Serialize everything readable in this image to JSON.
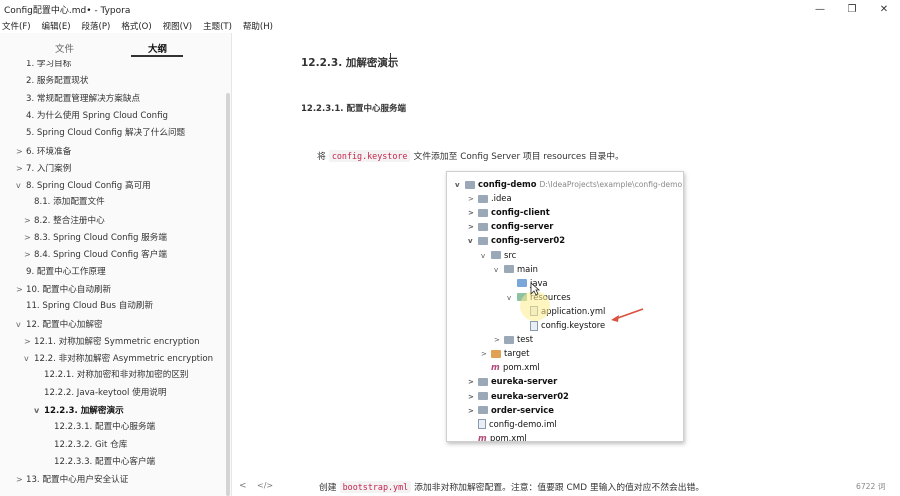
{
  "window": {
    "title": "Config配置中心.md• - Typora",
    "controls": {
      "minimize": "—",
      "maximize": "❐",
      "close": "✕"
    }
  },
  "menu": [
    "文件(F)",
    "编辑(E)",
    "段落(P)",
    "格式(O)",
    "视图(V)",
    "主题(T)",
    "帮助(H)"
  ],
  "sidebar": {
    "tabs": [
      "文件",
      "大纲"
    ],
    "active_tab": "大纲",
    "outline": [
      {
        "label": "1. 学习目标",
        "twisty": ""
      },
      {
        "label": "2. 服务配置现状",
        "twisty": ""
      },
      {
        "label": "3. 常规配置管理解决方案缺点",
        "twisty": ""
      },
      {
        "label": "4. 为什么使用 Spring Cloud Config",
        "twisty": ""
      },
      {
        "label": "5. Spring Cloud Config 解决了什么问题",
        "twisty": ""
      },
      {
        "label": "6. 环境准备",
        "twisty": ">"
      },
      {
        "label": "7. 入门案例",
        "twisty": ">"
      },
      {
        "label": "8. Spring Cloud Config 高可用",
        "twisty": "v"
      },
      {
        "label": "8.1. 添加配置文件",
        "twisty": ""
      },
      {
        "label": "8.2. 整合注册中心",
        "twisty": ">"
      },
      {
        "label": "8.3. Spring Cloud Config 服务端",
        "twisty": ">"
      },
      {
        "label": "8.4. Spring Cloud Config 客户端",
        "twisty": ">"
      },
      {
        "label": "9. 配置中心工作原理",
        "twisty": ""
      },
      {
        "label": "10. 配置中心自动刷新",
        "twisty": ">"
      },
      {
        "label": "11. Spring Cloud Bus 自动刷新",
        "twisty": ""
      },
      {
        "label": "12. 配置中心加解密",
        "twisty": "v"
      },
      {
        "label": "12.1. 对称加解密 Symmetric encryption",
        "twisty": ">"
      },
      {
        "label": "12.2. 非对称加解密 Asymmetric encryption",
        "twisty": "v"
      },
      {
        "label": "12.2.1. 对称加密和非对称加密的区别",
        "twisty": ""
      },
      {
        "label": "12.2.2. Java-keytool 使用说明",
        "twisty": ""
      },
      {
        "label": "12.2.3. 加解密演示",
        "twisty": "v"
      },
      {
        "label": "12.2.3.1. 配置中心服务端",
        "twisty": ""
      },
      {
        "label": "12.2.3.2. Git 仓库",
        "twisty": ""
      },
      {
        "label": "12.2.3.3. 配置中心客户端",
        "twisty": ""
      },
      {
        "label": "13. 配置中心用户安全认证",
        "twisty": ">"
      }
    ]
  },
  "content": {
    "heading_h3": "12.2.3. 加解密演示",
    "heading_h4": "12.2.3.1. 配置中心服务端",
    "para1": {
      "before": "将",
      "code": "config.keystore",
      "after": "文件添加至 Config Server 项目 resources 目录中。"
    },
    "para2": {
      "before": "创建",
      "code": "bootstrap.yml",
      "after": "添加非对称加解密配置。注意：值要跟 CMD 里输入的值对应不然会出错。"
    }
  },
  "project_tree": [
    {
      "label": "config-demo",
      "extra": "D:\\IdeaProjects\\example\\config-demo",
      "arrow": "v",
      "icon": "module",
      "bold": true
    },
    {
      "label": ".idea",
      "arrow": ">",
      "icon": "folder",
      "bold": false
    },
    {
      "label": "config-client",
      "arrow": ">",
      "icon": "module",
      "bold": true
    },
    {
      "label": "config-server",
      "arrow": ">",
      "icon": "module",
      "bold": true
    },
    {
      "label": "config-server02",
      "arrow": "v",
      "icon": "module",
      "bold": true
    },
    {
      "label": "src",
      "arrow": "v",
      "icon": "folder",
      "bold": false
    },
    {
      "label": "main",
      "arrow": "v",
      "icon": "folder",
      "bold": false
    },
    {
      "label": "java",
      "arrow": "",
      "icon": "blue",
      "bold": false
    },
    {
      "label": "resources",
      "arrow": "v",
      "icon": "green",
      "bold": false
    },
    {
      "label": "application.yml",
      "arrow": "",
      "icon": "file",
      "bold": false
    },
    {
      "label": "config.keystore",
      "arrow": "",
      "icon": "file",
      "bold": false
    },
    {
      "label": "test",
      "arrow": ">",
      "icon": "folder",
      "bold": false
    },
    {
      "label": "target",
      "arrow": ">",
      "icon": "orange",
      "bold": false
    },
    {
      "label": "pom.xml",
      "arrow": "",
      "icon": "maven",
      "bold": false
    },
    {
      "label": "eureka-server",
      "arrow": ">",
      "icon": "module",
      "bold": true
    },
    {
      "label": "eureka-server02",
      "arrow": ">",
      "icon": "module",
      "bold": true
    },
    {
      "label": "order-service",
      "arrow": ">",
      "icon": "module",
      "bold": true
    },
    {
      "label": "config-demo.iml",
      "arrow": "",
      "icon": "file",
      "bold": false
    },
    {
      "label": "pom.xml",
      "arrow": "",
      "icon": "maven",
      "bold": false
    }
  ],
  "status": {
    "left_icon": "<",
    "code_icon": "</>",
    "word_count": "6722 词"
  },
  "colors": {
    "accent_arrow": "#d9533f",
    "code_text": "#c7254e"
  }
}
